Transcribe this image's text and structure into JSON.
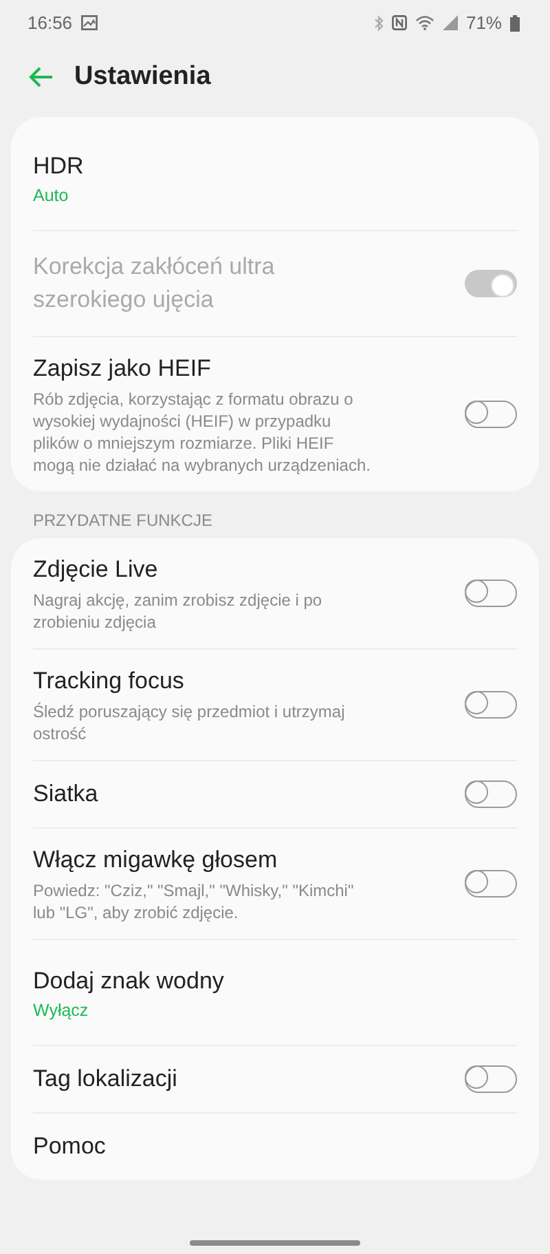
{
  "status_bar": {
    "time": "16:56",
    "battery": "71%"
  },
  "header": {
    "title": "Ustawienia"
  },
  "sections": [
    {
      "items": [
        {
          "kind": "value",
          "title": "HDR",
          "value": "Auto"
        },
        {
          "kind": "toggle",
          "title": "Korekcja zakłóceń ultra szerokiego ujęcia",
          "on": true,
          "disabled": true
        },
        {
          "kind": "toggle",
          "title": "Zapisz jako HEIF",
          "subtitle": "Rób zdjęcia, korzystając z formatu obrazu o wysokiej wydajności (HEIF) w przypadku plików o mniejszym rozmiarze. Pliki HEIF mogą nie działać na wybranych urządzeniach.",
          "on": false,
          "disabled": false
        }
      ]
    },
    {
      "header": "PRZYDATNE FUNKCJE",
      "items": [
        {
          "kind": "toggle",
          "title": "Zdjęcie Live",
          "subtitle": "Nagraj akcję, zanim zrobisz zdjęcie i po zrobieniu zdjęcia",
          "on": false,
          "disabled": false
        },
        {
          "kind": "toggle",
          "title": "Tracking focus",
          "subtitle": "Śledź poruszający się przedmiot i utrzymaj ostrość",
          "on": false,
          "disabled": false
        },
        {
          "kind": "toggle",
          "title": "Siatka",
          "on": false,
          "disabled": false
        },
        {
          "kind": "toggle",
          "title": "Włącz migawkę głosem",
          "subtitle": "Powiedz: \"Cziz,\" \"Smajl,\" \"Whisky,\" \"Kimchi\" lub \"LG\", aby zrobić zdjęcie.",
          "on": false,
          "disabled": false
        },
        {
          "kind": "value",
          "title": "Dodaj znak wodny",
          "value": "Wyłącz"
        },
        {
          "kind": "toggle",
          "title": "Tag lokalizacji",
          "on": false,
          "disabled": false
        },
        {
          "kind": "link",
          "title": "Pomoc"
        }
      ]
    }
  ]
}
